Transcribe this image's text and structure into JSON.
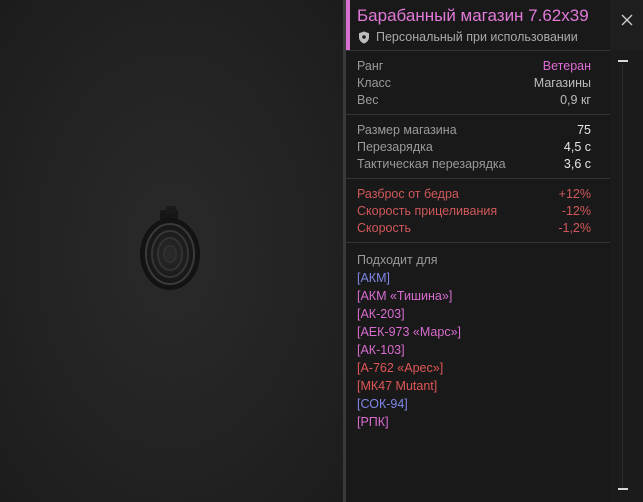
{
  "item": {
    "title": "Барабанный магазин 7.62x39",
    "subtitle": "Персональный при использовании",
    "title_color": "#e17ad9",
    "icon": "drum-magazine"
  },
  "info": [
    {
      "key": "Ранг",
      "value": "Ветеран"
    },
    {
      "key": "Класс",
      "value": "Магазины"
    },
    {
      "key": "Вес",
      "value": "0,9 кг"
    }
  ],
  "stats": [
    {
      "key": "Размер магазина",
      "value": "75"
    },
    {
      "key": "Перезарядка",
      "value": "4,5 с"
    },
    {
      "key": "Тактическая перезарядка",
      "value": "3,6 с"
    }
  ],
  "penalties": [
    {
      "key": "Разброс от бедра",
      "value": "+12%"
    },
    {
      "key": "Скорость прицеливания",
      "value": "-12%"
    },
    {
      "key": "Скорость",
      "value": "-1,2%"
    }
  ],
  "compatible": {
    "title": "Подходит для",
    "items": [
      {
        "name": "[АКМ]",
        "color": "#7f86e6"
      },
      {
        "name": "[АКМ «Тишина»]",
        "color": "#d86cd0"
      },
      {
        "name": "[АК-203]",
        "color": "#d86cd0"
      },
      {
        "name": "[АЕК-973 «Марс»]",
        "color": "#d86cd0"
      },
      {
        "name": "[АК-103]",
        "color": "#d86cd0"
      },
      {
        "name": "[А-762 «Арес»]",
        "color": "#e05656"
      },
      {
        "name": "[МК47 Mutant]",
        "color": "#e05656"
      },
      {
        "name": "[СОК-94]",
        "color": "#7f86e6"
      },
      {
        "name": "[РПК]",
        "color": "#d86cd0"
      }
    ]
  },
  "colors": {
    "accent": "#d96fd1",
    "negative": "#d0585a",
    "rank": "#e06bd6"
  }
}
